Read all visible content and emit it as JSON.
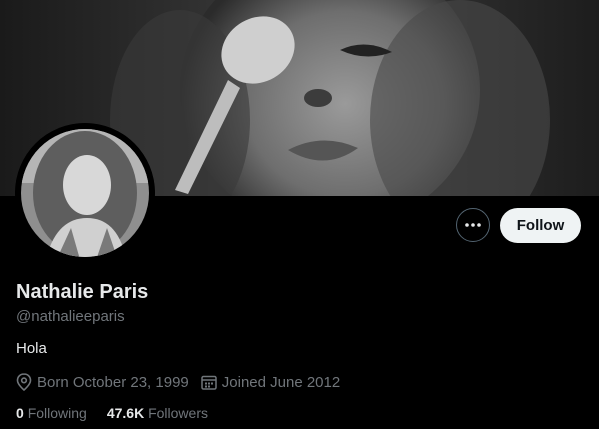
{
  "profile": {
    "display_name": "Nathalie Paris",
    "handle": "@nathalieeparis",
    "bio": "Hola",
    "born": "Born October 23, 1999",
    "joined": "Joined June 2012",
    "following_count": "0",
    "following_label": "Following",
    "followers_count": "47.6K",
    "followers_label": "Followers"
  },
  "actions": {
    "follow_label": "Follow",
    "more_icon": "ellipsis-icon"
  },
  "icons": {
    "location": "location-pin-icon",
    "calendar": "calendar-icon"
  },
  "colors": {
    "background": "#000000",
    "text_primary": "#e7e9ea",
    "text_secondary": "#71767b",
    "follow_button_bg": "#eff3f4",
    "follow_button_text": "#0f1419",
    "border": "#536471"
  }
}
